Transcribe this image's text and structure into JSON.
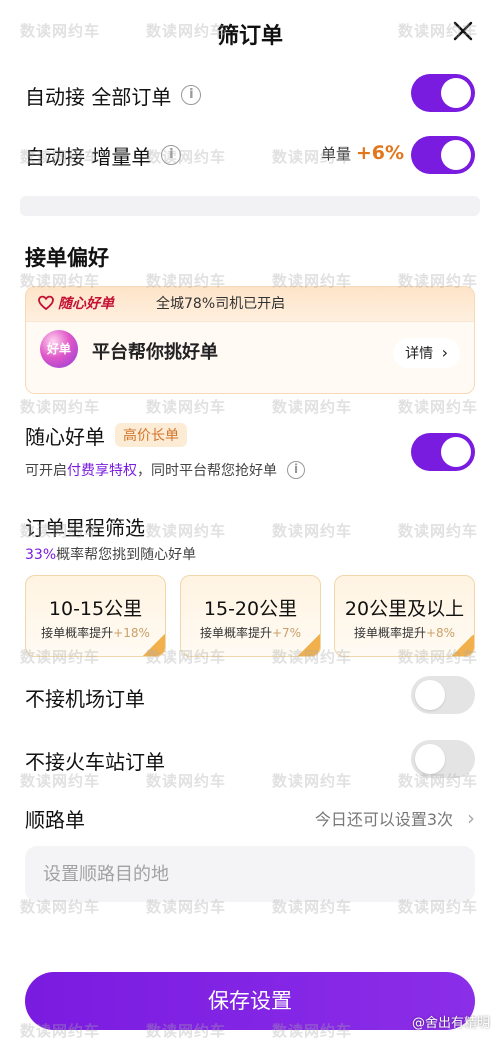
{
  "header": {
    "title": "筛订单",
    "close_label": "✕"
  },
  "auto_accept_all": {
    "label": "自动接 全部订单",
    "info": "i",
    "enabled": true
  },
  "auto_accept_increment": {
    "label": "自动接 增量单",
    "info": "i",
    "badge_prefix": "单量",
    "badge_value": "+6%",
    "enabled": true
  },
  "preference": {
    "title": "接单偏好",
    "card": {
      "brand": "随心好单",
      "share_text": "全城78%司机已开启",
      "gem_text": "好单",
      "slogan": "平台帮你挑好单",
      "detail_label": "详情",
      "detail_chevron": "›"
    }
  },
  "suixin": {
    "label": "随心好单",
    "tag": "高价长单",
    "enabled": true,
    "desc_prefix": "可开启",
    "desc_em": "付费享特权",
    "desc_suffix": "，同时平台帮您抢好单",
    "info": "i"
  },
  "mileage": {
    "title": "订单里程筛选",
    "subtitle_em": "33%",
    "subtitle": "概率帮您挑到随心好单",
    "options": [
      {
        "title": "10-15公里",
        "sub": "接单概率提升",
        "plus": "+18%"
      },
      {
        "title": "15-20公里",
        "sub": "接单概率提升",
        "plus": "+7%"
      },
      {
        "title": "20公里及以上",
        "sub": "接单概率提升",
        "plus": "+8%"
      }
    ]
  },
  "no_airport": {
    "label": "不接机场订单",
    "enabled": false
  },
  "no_train": {
    "label": "不接火车站订单",
    "enabled": false
  },
  "route": {
    "label": "顺路单",
    "right_text": "今日还可以设置3次",
    "chevron": "›",
    "input_placeholder": "设置顺路目的地"
  },
  "save_label": "保存设置",
  "watermark_text": "数读网约车",
  "source_tag": "@舍出有精明",
  "colors": {
    "accent": "#7a1be0",
    "toggle_off": "#e4e4e4",
    "tag_orange": "#d2752b"
  }
}
